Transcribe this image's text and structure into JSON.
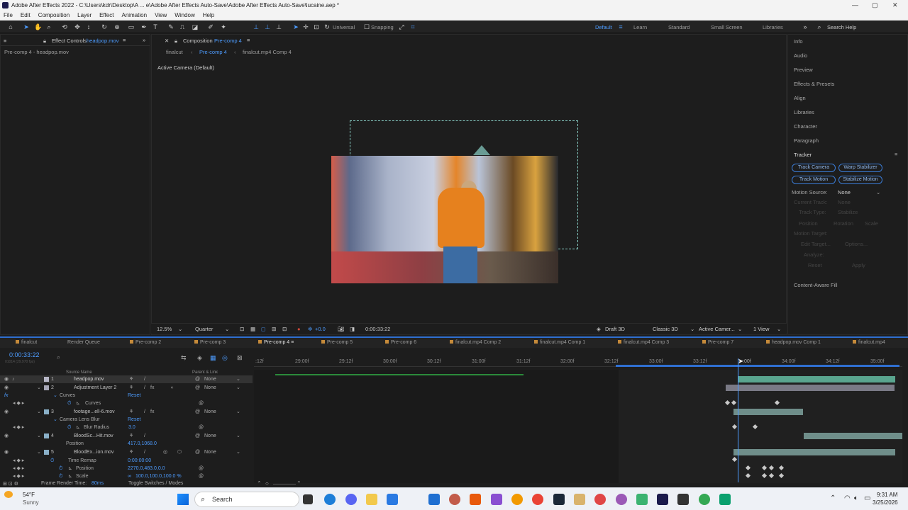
{
  "window": {
    "title": "Adobe After Effects 2022 - C:\\Users\\kdr\\Desktop\\A ... e\\Adobe After Effects Auto-Save\\Adobe After Effects Auto-Save\\lucaine.aep *"
  },
  "menu": [
    "File",
    "Edit",
    "Composition",
    "Layer",
    "Effect",
    "Animation",
    "View",
    "Window",
    "Help"
  ],
  "toolbar": {
    "universal": "Universal",
    "snapping": "Snapping"
  },
  "workspaces": {
    "default": "Default",
    "learn": "Learn",
    "standard": "Standard",
    "small_screen": "Small Screen",
    "libraries": "Libraries",
    "search_help": "Search Help"
  },
  "effect_controls": {
    "tab_label": "Effect Controls",
    "tab_layer": "headpop.mov",
    "subtitle": "Pre-comp 4 - headpop.mov"
  },
  "composition": {
    "tab_label": "Composition",
    "tab_comp": "Pre-comp 4",
    "breadcrumbs": [
      "finalcut",
      "Pre-comp 4",
      "finalcut.mp4 Comp 4"
    ],
    "active_camera": "Active Camera (Default)",
    "zoom": "12.5%",
    "resolution": "Quarter",
    "exposure": "+0.0",
    "timecode": "0:00:33:22",
    "draft3d": "Draft 3D",
    "renderer": "Classic 3D",
    "camera_select": "Active Camer...",
    "view_select": "1 View"
  },
  "right_panel": {
    "items": [
      "Info",
      "Audio",
      "Preview",
      "Effects & Presets",
      "Align",
      "Libraries",
      "Character",
      "Paragraph"
    ],
    "tracker_title": "Tracker",
    "tracker_buttons": [
      "Track Camera",
      "Warp Stabilizer",
      "Track Motion",
      "Stabilize Motion"
    ],
    "motion_source_label": "Motion Source:",
    "motion_source_value": "None",
    "current_track": "Current Track:",
    "current_track_val": "None",
    "track_type": "Track Type:",
    "track_type_val": "Stabilize",
    "position": "Position",
    "rotation": "Rotation",
    "scale": "Scale",
    "motion_target": "Motion Target:",
    "edit_target": "Edit Target...",
    "options": "Options...",
    "analyze": "Analyze:",
    "reset": "Reset",
    "apply": "Apply",
    "content_aware": "Content-Aware Fill"
  },
  "timeline": {
    "tabs": [
      "finalcut",
      "Render Queue",
      "Pre-comp 2",
      "Pre-comp 3",
      "Pre-comp 4",
      "Pre-comp 5",
      "Pre-comp 6",
      "finalcut.mp4 Comp 2",
      "finalcut.mp4 Comp 1",
      "finalcut.mp4 Comp 3",
      "Pre-comp 7",
      "headpop.mov Comp 1",
      "finalcut.mp4"
    ],
    "timecode": "0:00:33:22",
    "timecode_sub": "01014 (29.970 fps)",
    "col_source": "Source Name",
    "col_parent": "Parent & Link",
    "ruler": [
      ":12f",
      "29:00f",
      "29:12f",
      "30:00f",
      "30:12f",
      "31:00f",
      "31:12f",
      "32:00f",
      "32:12f",
      "33:00f",
      "33:12f",
      "34:00f",
      "34:12f",
      "35:00f",
      "35:12f"
    ],
    "ruler_cti": ":00f",
    "layers": [
      {
        "num": "1",
        "name": "headpop.mov",
        "parent": "None"
      },
      {
        "num": "2",
        "name": "Adjustment Layer 2",
        "parent": "None"
      },
      {
        "num": "3",
        "name": "footage...ell-6.mov",
        "parent": "None"
      },
      {
        "num": "4",
        "name": "BloodSc...Hit.mov",
        "parent": "None"
      },
      {
        "num": "5",
        "name": "BloodEx...ion.mov",
        "parent": "None"
      }
    ],
    "props": {
      "curves_fx": "Curves",
      "reset": "Reset",
      "curves": "Curves",
      "camera_lens_blur": "Camera Lens Blur",
      "blur_radius": "Blur Radius",
      "blur_radius_val": "3.0",
      "position": "Position",
      "position_val_4": "417.0,1068.0",
      "time_remap": "Time Remap",
      "time_remap_val": "0:00:00:00",
      "position_val_5": "2270.0,483.0,0.0",
      "scale": "Scale",
      "scale_val": "100.0,100.0,100.0 %"
    },
    "footer_render": "Frame Render Time:",
    "footer_render_val": "80ms",
    "footer_toggle": "Toggle Switches / Modes"
  },
  "taskbar": {
    "temp": "54°F",
    "weather": "Sunny",
    "search": "Search",
    "time": "9:31 AM",
    "date": "3/25/2026"
  }
}
